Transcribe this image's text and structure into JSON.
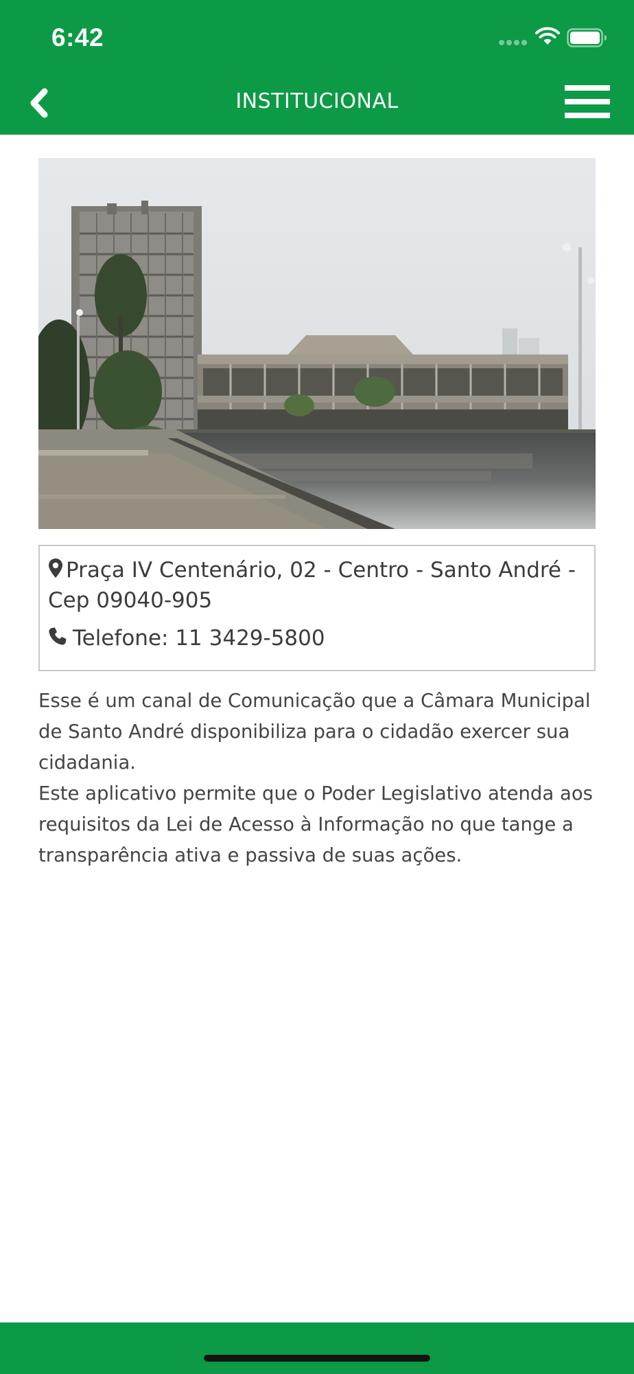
{
  "status_bar": {
    "time": "6:42"
  },
  "nav": {
    "title": "INSTITUCIONAL",
    "back_icon": "chevron-left-icon",
    "menu_icon": "hamburger-menu-icon"
  },
  "photo": {
    "alt": "Câmara Municipal de Santo André"
  },
  "info": {
    "address_line1": "Praça IV Centenário, 02 - Centro - Santo André -",
    "address_line2": "Cep 09040-905",
    "address_icon": "map-marker-icon",
    "phone": "Telefone: 11 3429-5800",
    "phone_icon": "phone-icon"
  },
  "description": {
    "paragraph1": "Esse é um canal de Comunicação que a Câmara Municipal de Santo André disponibiliza para o cidadão exercer sua cidadania.",
    "paragraph2": "Este aplicativo permite que o Poder Legislativo atenda aos requisitos da Lei de Acesso à Informação no que tange a transparência ativa e passiva de suas ações."
  },
  "colors": {
    "brand_green": "#0c9a46",
    "text": "#3c3c3c",
    "border": "#c9c9c9"
  }
}
